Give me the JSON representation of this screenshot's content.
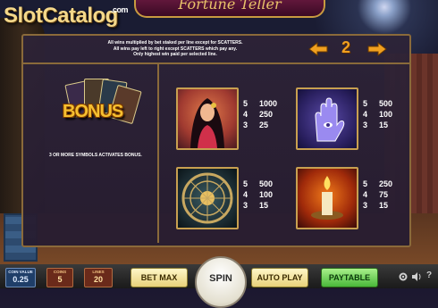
{
  "logo": {
    "text": "SlotCatalog",
    "suffix": ".com"
  },
  "game_title": "Fortune Teller",
  "rules": [
    "All wins multiplied by bet staked per line except for SCATTERS.",
    "All wins pay left to right except SCATTERS which pay any.",
    "Only highest win paid per selected line."
  ],
  "page": {
    "number": "2"
  },
  "bonus": {
    "word": "BONUS",
    "note": "3 OR MORE SYMBOLS ACTIVATES BONUS."
  },
  "symbols": [
    {
      "name": "fortune-teller-woman",
      "pays": [
        {
          "count": "5",
          "value": "1000"
        },
        {
          "count": "4",
          "value": "250"
        },
        {
          "count": "3",
          "value": "25"
        }
      ]
    },
    {
      "name": "palm-hand",
      "pays": [
        {
          "count": "5",
          "value": "500"
        },
        {
          "count": "4",
          "value": "100"
        },
        {
          "count": "3",
          "value": "15"
        }
      ]
    },
    {
      "name": "zodiac-wheel",
      "pays": [
        {
          "count": "5",
          "value": "500"
        },
        {
          "count": "4",
          "value": "100"
        },
        {
          "count": "3",
          "value": "15"
        }
      ]
    },
    {
      "name": "candle",
      "pays": [
        {
          "count": "5",
          "value": "250"
        },
        {
          "count": "4",
          "value": "75"
        },
        {
          "count": "3",
          "value": "15"
        }
      ]
    }
  ],
  "controls": {
    "coin_value_label": "COIN VALUE",
    "coin_value": "0.25",
    "coins_label": "COINS",
    "coins": "5",
    "lines_label": "LINES",
    "lines": "20",
    "bet_max": "BET MAX",
    "spin": "SPIN",
    "auto_play": "AUTO PLAY",
    "paytable": "PAYTABLE",
    "help": "?"
  },
  "colors": {
    "accent_gold": "#c8a050",
    "page_number": "#f0a020",
    "paytable_green": "#4ab83a"
  }
}
